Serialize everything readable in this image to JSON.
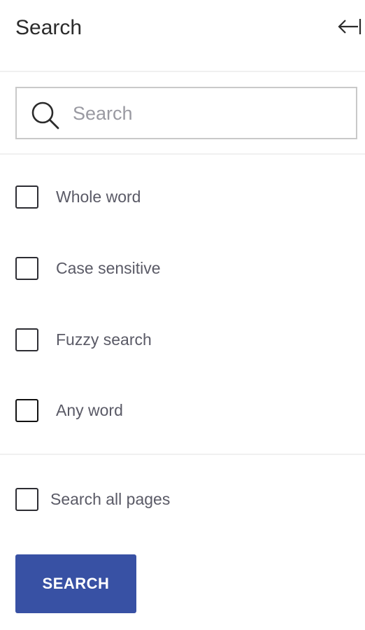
{
  "panel": {
    "title": "Search",
    "collapse_icon": "collapse-left-icon"
  },
  "search": {
    "placeholder": "Search",
    "value": "",
    "icon": "search-icon"
  },
  "options": [
    {
      "label": "Whole word",
      "checked": false
    },
    {
      "label": "Case sensitive",
      "checked": false
    },
    {
      "label": "Fuzzy search",
      "checked": false
    },
    {
      "label": "Any word",
      "checked": false
    }
  ],
  "search_all_pages": {
    "label": "Search all pages",
    "checked": false
  },
  "search_button": {
    "label": "SEARCH"
  },
  "colors": {
    "button": "#3851a4",
    "label": "#5a5a66",
    "placeholder": "#9a9aa2",
    "border": "#c9c9c9"
  }
}
